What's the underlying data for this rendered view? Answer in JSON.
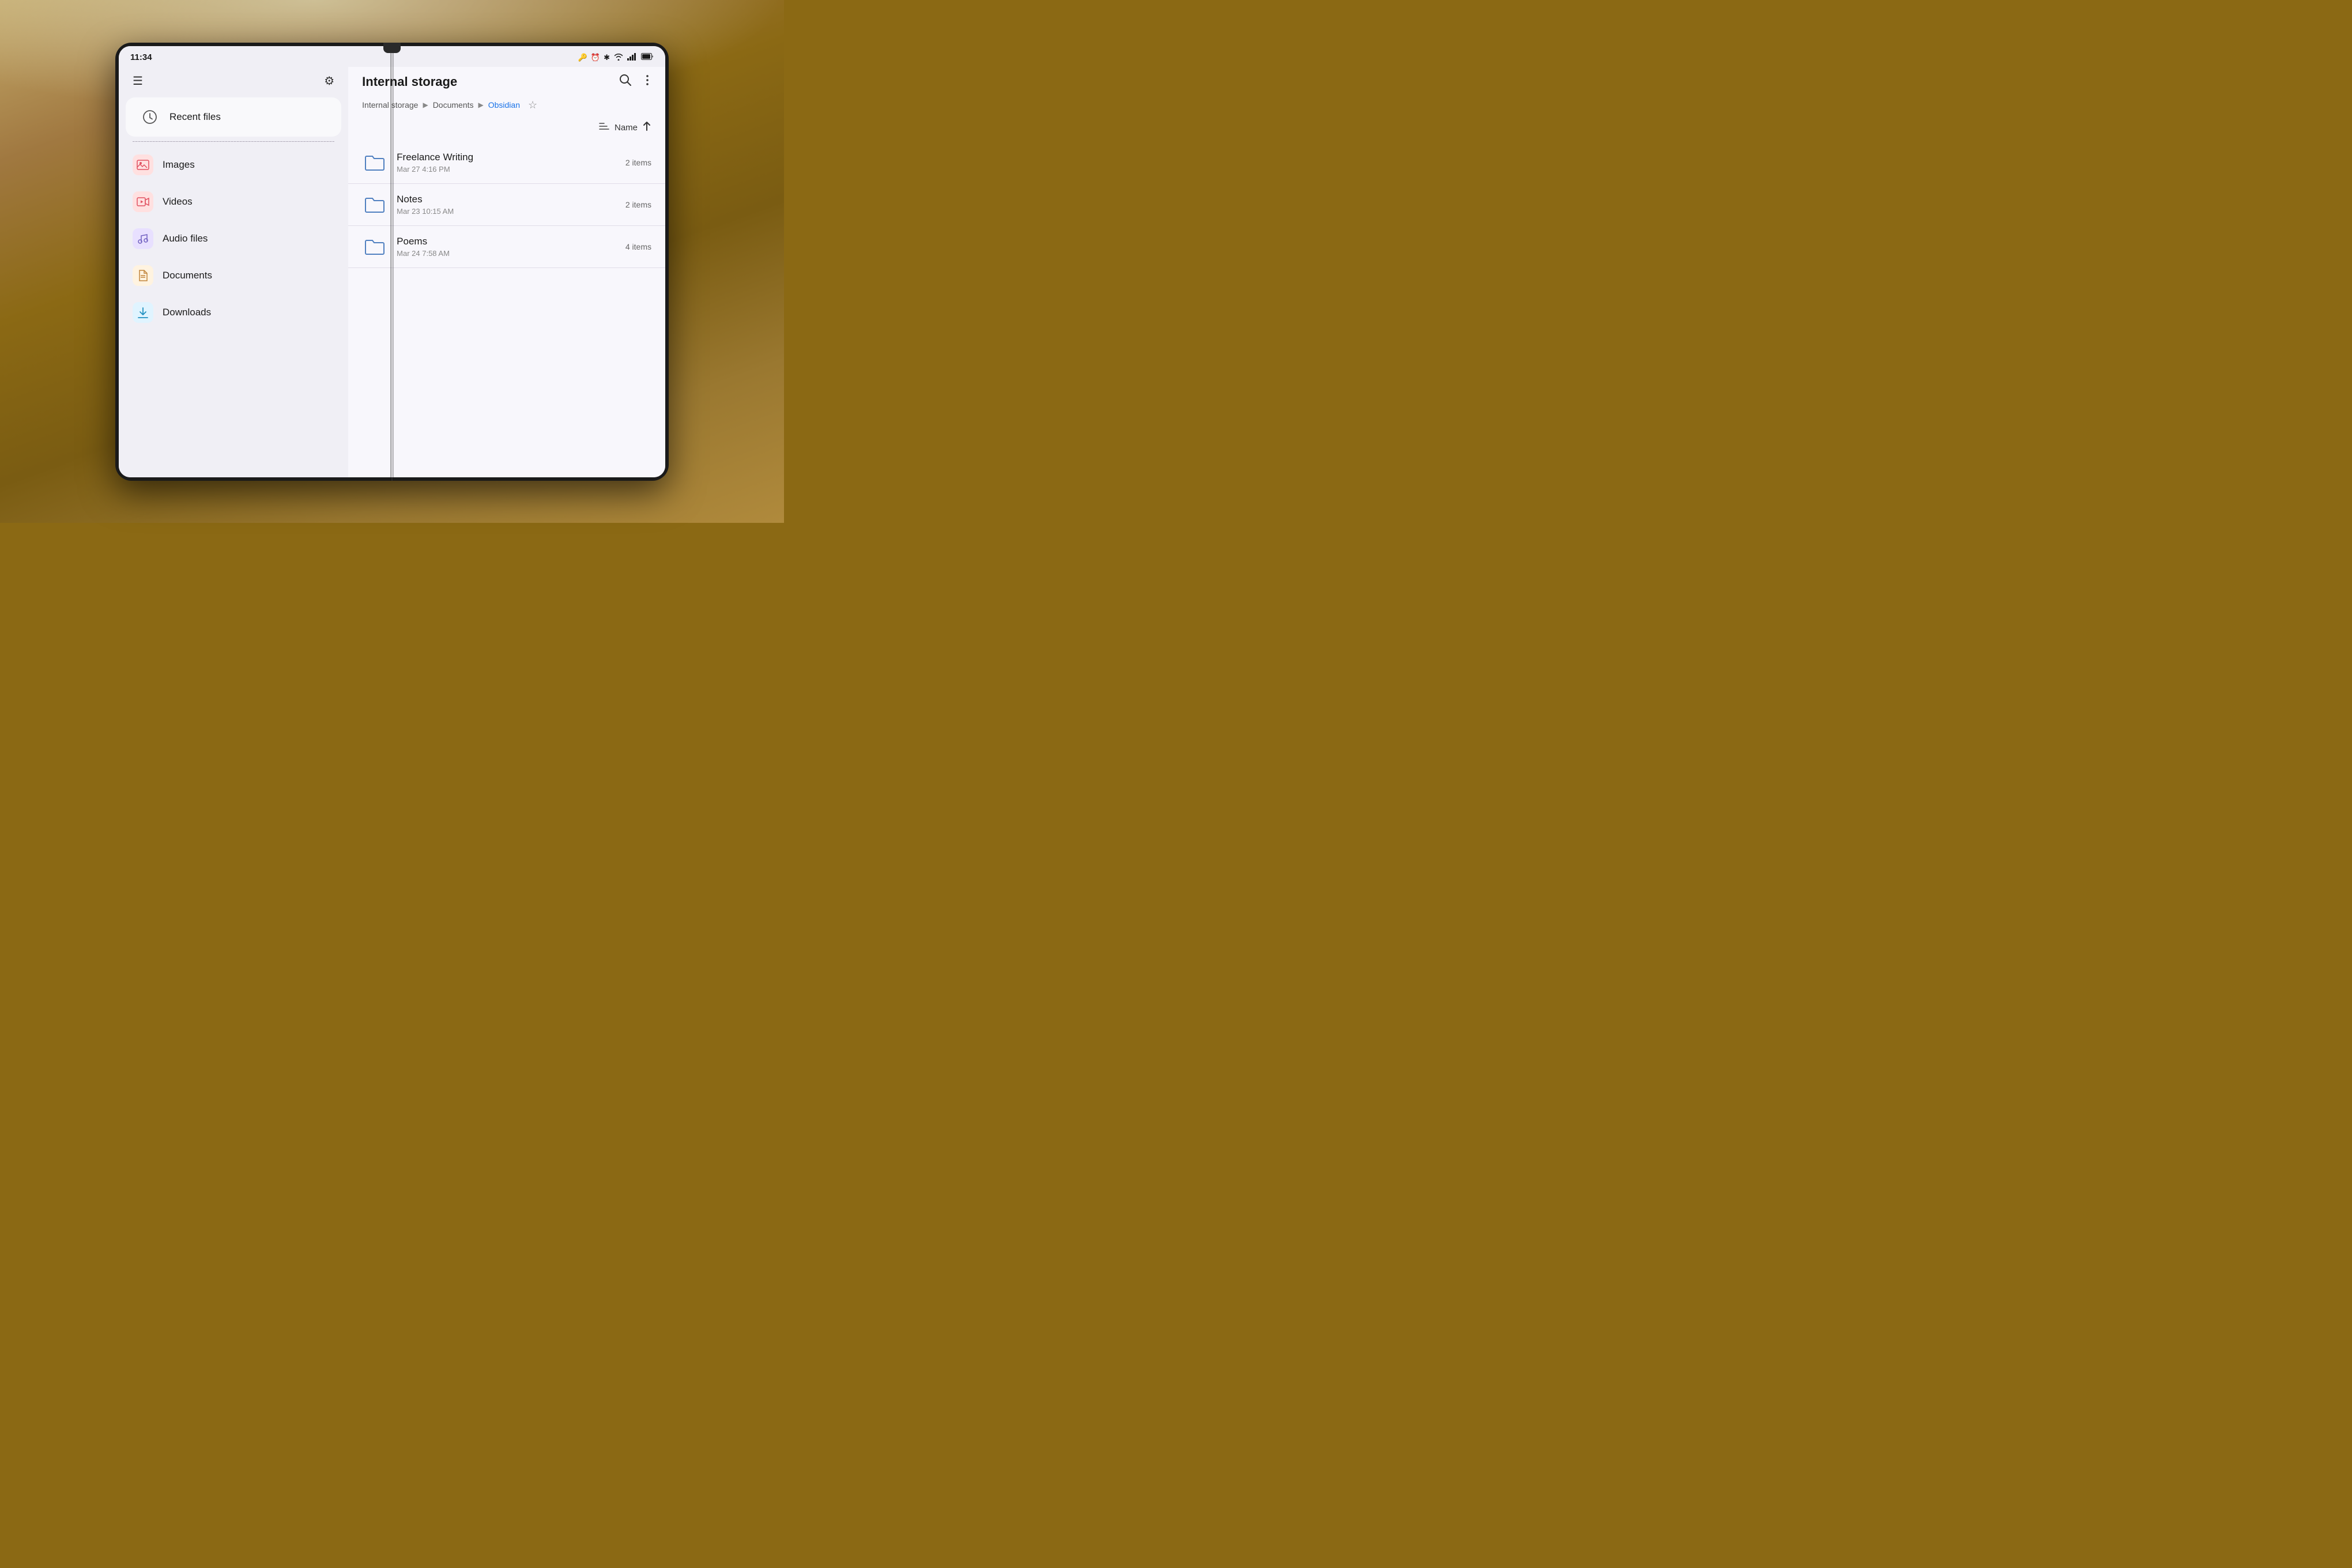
{
  "background": {
    "type": "wood"
  },
  "status_bar": {
    "time": "11:34",
    "icons": [
      "🔑",
      "⏰",
      "✱",
      "⬡",
      "📶",
      "🔋"
    ]
  },
  "left_panel": {
    "header": {
      "menu_label": "☰",
      "settings_label": "⚙"
    },
    "nav_items": [
      {
        "id": "recent",
        "icon": "🕐",
        "label": "Recent files",
        "type": "recent"
      },
      {
        "id": "images",
        "icon": "🖼",
        "label": "Images",
        "type": "images"
      },
      {
        "id": "videos",
        "icon": "▶",
        "label": "Videos",
        "type": "videos"
      },
      {
        "id": "audio",
        "icon": "♪",
        "label": "Audio files",
        "type": "audio"
      },
      {
        "id": "documents",
        "icon": "📄",
        "label": "Documents",
        "type": "docs"
      },
      {
        "id": "downloads",
        "icon": "⬇",
        "label": "Downloads",
        "type": "downloads"
      }
    ]
  },
  "right_panel": {
    "title": "Internal storage",
    "breadcrumb": [
      {
        "text": "Internal storage",
        "active": false
      },
      {
        "text": "Documents",
        "active": false
      },
      {
        "text": "Obsidian",
        "active": true
      }
    ],
    "sort": {
      "icon": "≡↑",
      "label": "Name",
      "direction": "↑"
    },
    "files": [
      {
        "name": "Freelance Writing",
        "date": "Mar 27 4:16 PM",
        "count": "2 items"
      },
      {
        "name": "Notes",
        "date": "Mar 23 10:15 AM",
        "count": "2 items"
      },
      {
        "name": "Poems",
        "date": "Mar 24 7:58 AM",
        "count": "4 items"
      }
    ]
  }
}
